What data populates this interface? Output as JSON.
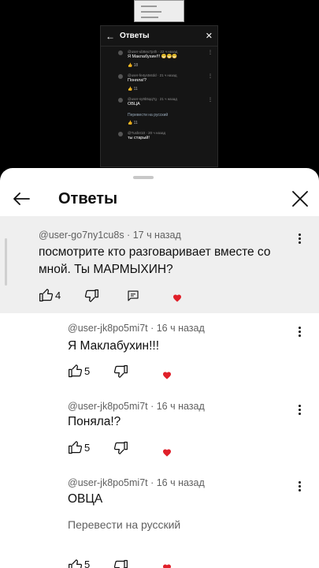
{
  "background_video": {
    "header_title": "Ответы",
    "comments": [
      {
        "author": "@user-ub8eu7p4h · 22 ч назад",
        "text": "Я Маклабухин!!! 😁😁😁",
        "likes": "18"
      },
      {
        "author": "@user-fe4ys5stdd · 21 ч назад",
        "text": "Поняла!?",
        "likes": "11"
      },
      {
        "author": "@user-sy9b5qq7g · 21 ч назад",
        "text": "ОВЦА",
        "translate": "Перевести на русский",
        "likes": "11"
      },
      {
        "author": "@Tusfer10 · 20 ч назад",
        "text": "ты старый!"
      }
    ]
  },
  "sheet": {
    "title": "Ответы",
    "parent": {
      "author": "@user-go7ny1cu8s · 17 ч назад",
      "text": "посмотрите кто разговаривает вместе со мной. Ты МАРМЫХИН?",
      "likes": "4"
    },
    "replies": [
      {
        "author": "@user-jk8po5mi7t · 16 ч назад",
        "text": "Я Маклабухин!!!",
        "likes": "5"
      },
      {
        "author": "@user-jk8po5mi7t · 16 ч назад",
        "text": "Поняла!?",
        "likes": "5"
      },
      {
        "author": "@user-jk8po5mi7t · 16 ч назад",
        "text": "ОВЦА",
        "translate": "Перевести на русский",
        "likes": "5"
      }
    ]
  },
  "icons": {
    "back": "arrow-left-icon",
    "close": "close-icon",
    "menu": "more-vert-icon",
    "like": "thumb-up-icon",
    "dislike": "thumb-down-icon",
    "reply": "reply-icon",
    "heart": "creator-heart-icon"
  },
  "colors": {
    "heart": "#e0202a",
    "secondary_text": "#606060",
    "parent_bg": "#efefef"
  }
}
